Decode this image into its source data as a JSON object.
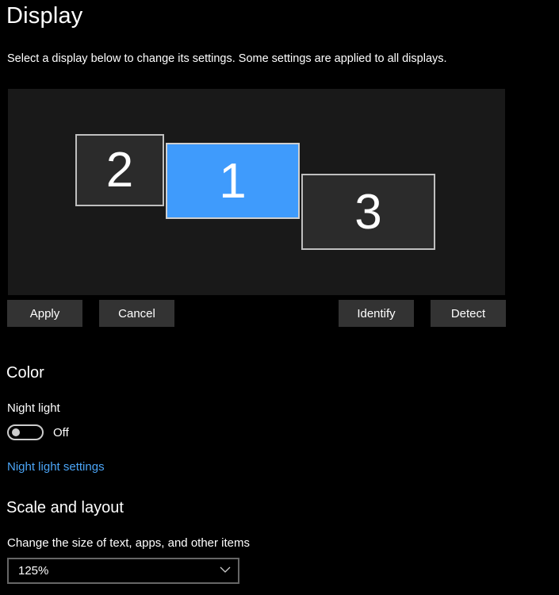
{
  "header": {
    "title": "Display",
    "description": "Select a display below to change its settings. Some settings are applied to all displays."
  },
  "displays": [
    {
      "number": "2",
      "selected": false
    },
    {
      "number": "1",
      "selected": true
    },
    {
      "number": "3",
      "selected": false
    }
  ],
  "buttons": {
    "apply": "Apply",
    "cancel": "Cancel",
    "identify": "Identify",
    "detect": "Detect"
  },
  "color_section": {
    "heading": "Color",
    "night_light_label": "Night light",
    "night_light_state": "Off",
    "night_light_on": false,
    "night_light_settings_link": "Night light settings"
  },
  "scale_section": {
    "heading": "Scale and layout",
    "size_label": "Change the size of text, apps, and other items",
    "size_value": "125%"
  },
  "colors": {
    "accent": "#3f9bfc",
    "link": "#4ba5f7",
    "background": "#000000",
    "button": "#333333"
  }
}
